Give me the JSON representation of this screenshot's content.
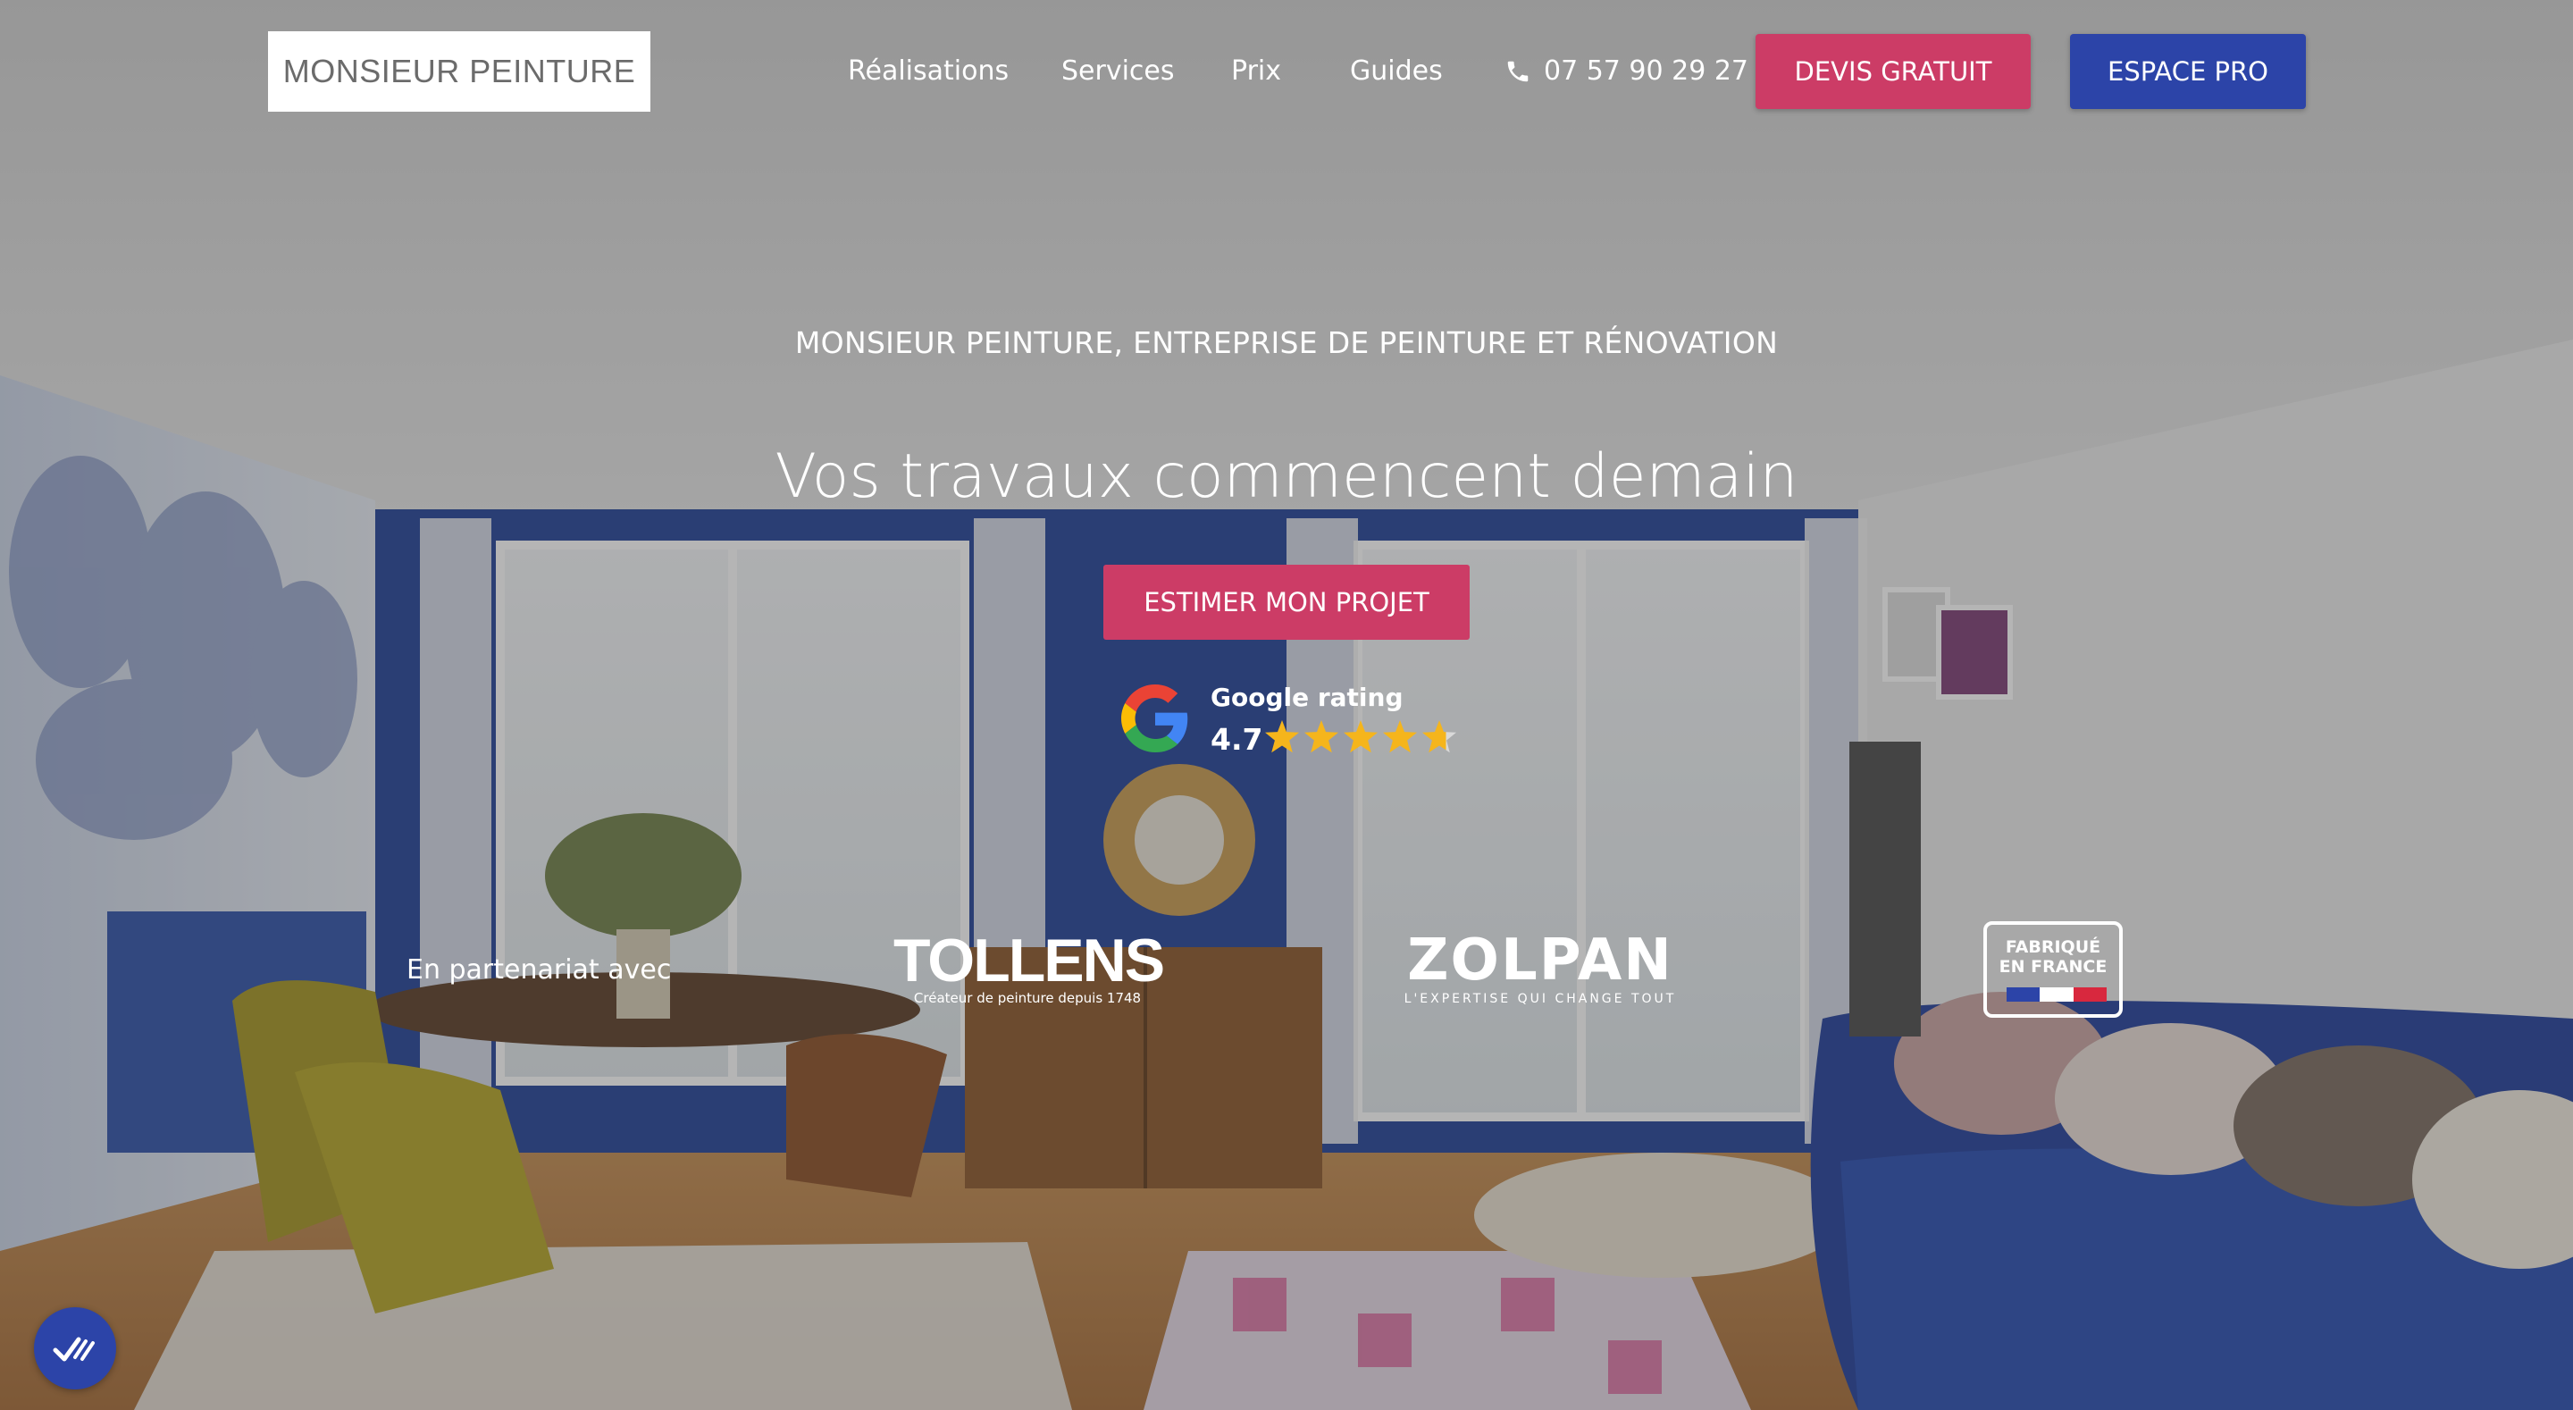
{
  "header": {
    "logo": "MONSIEUR PEINTURE",
    "nav": [
      "Réalisations",
      "Services",
      "Prix",
      "Guides"
    ],
    "phone": "07 57 90 29 27",
    "devis_button": "DEVIS GRATUIT",
    "pro_button": "ESPACE PRO"
  },
  "hero": {
    "eyebrow": "MONSIEUR PEINTURE, ENTREPRISE DE PEINTURE ET RÉNOVATION",
    "headline": "Vos travaux commencent demain",
    "cta": "ESTIMER MON PROJET"
  },
  "rating": {
    "label": "Google rating",
    "value": "4.7",
    "stars_filled": 4.7,
    "stars_max": 5
  },
  "partners": {
    "label": "En partenariat avec",
    "tollens": {
      "name": "TOLLENS",
      "tagline": "Créateur de peinture depuis 1748"
    },
    "zolpan": {
      "name": "ZOLPAN",
      "tagline": "L'EXPERTISE QUI CHANGE TOUT"
    },
    "fabrique": [
      "FABRIQUÉ",
      "EN FRANCE"
    ]
  },
  "colors": {
    "accent_pink": "#cc3c66",
    "accent_blue": "#2c44a8",
    "star": "#f5b51c"
  },
  "icons": {
    "phone": "phone-icon",
    "google": "google-g-icon",
    "accessibility": "accessibility-icon"
  }
}
